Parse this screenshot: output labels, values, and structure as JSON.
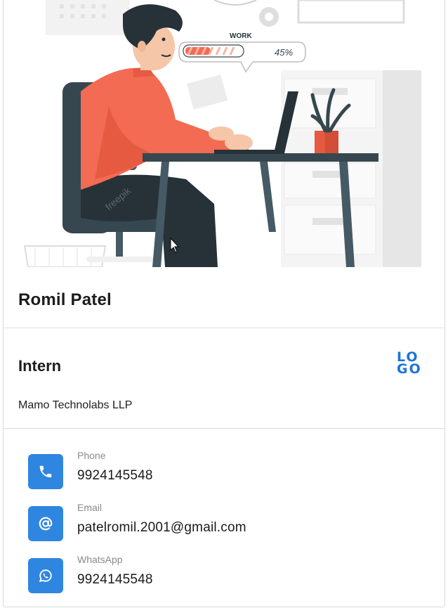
{
  "hero": {
    "work_label": "WORK",
    "work_progress_text": "45%",
    "work_progress_value": 0.45,
    "watermark": "freepik"
  },
  "profile": {
    "name": "Romil Patel",
    "role": "Intern",
    "company": "Mamo Technolabs LLP",
    "logo_lines": [
      "LO",
      "GO"
    ]
  },
  "contacts": [
    {
      "label": "Phone",
      "value": "9924145548",
      "icon": "phone-icon"
    },
    {
      "label": "Email",
      "value": "patelromil.2001@gmail.com",
      "icon": "at-sign-icon"
    },
    {
      "label": "WhatsApp",
      "value": "9924145548",
      "icon": "whatsapp-icon"
    }
  ],
  "colors": {
    "accent": "#2f86e0",
    "logo": "#1e74d6",
    "shirt": "#f26b52",
    "furniture": "#37474f"
  }
}
